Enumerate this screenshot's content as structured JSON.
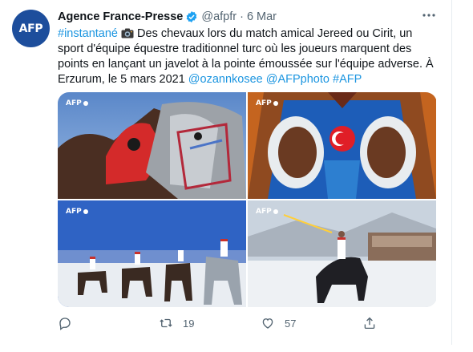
{
  "tweet": {
    "avatar_text": "AFP",
    "author_name": "Agence France-Presse",
    "handle": "@afpfr",
    "separator": "·",
    "date": "6 Mar",
    "hashtag": "#instantané",
    "body": " Des chevaux lors du match amical Jereed ou Cirit, un sport d'équipe équestre traditionnel turc où les joueurs marquent des points en lançant un javelot à la pointe émoussée sur l'équipe adverse. À Erzurum, le 5 mars 2021 ",
    "mentions": [
      "@ozannkosee",
      "@AFPphoto",
      "#AFP"
    ],
    "photo_watermarks": [
      "AFP",
      "AFP",
      "AFP",
      "AFP"
    ],
    "replies": "",
    "retweets": "19",
    "likes": "57"
  },
  "colors": {
    "link": "#1b95e0",
    "avatar_bg": "#1d4e9c",
    "verified": "#1da1f2",
    "muted": "#536471"
  },
  "icons": [
    "verified-badge-icon",
    "more-icon",
    "camera-icon",
    "reply-icon",
    "retweet-icon",
    "like-icon",
    "share-icon"
  ]
}
